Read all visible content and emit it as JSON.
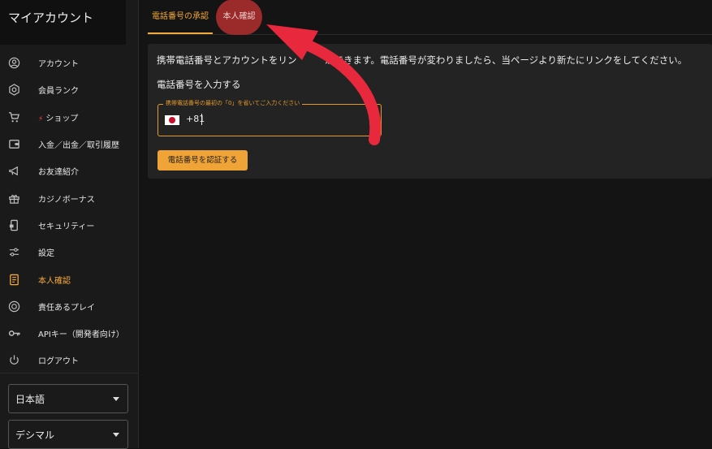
{
  "sidebar": {
    "title": "マイアカウント",
    "items": [
      {
        "label": "アカウント",
        "icon": "user-circle-icon",
        "name": "sidebar-item-account"
      },
      {
        "label": "会員ランク",
        "icon": "badge-hexagon-icon",
        "name": "sidebar-item-rank"
      },
      {
        "label": "ショップ",
        "icon": "cart-icon",
        "name": "sidebar-item-shop",
        "prefix_icon": "lightning-icon"
      },
      {
        "label": "入金／出金／取引履歴",
        "icon": "wallet-icon",
        "name": "sidebar-item-transactions"
      },
      {
        "label": "お友達紹介",
        "icon": "megaphone-icon",
        "name": "sidebar-item-referral"
      },
      {
        "label": "カジノボーナス",
        "icon": "gift-icon",
        "name": "sidebar-item-bonus"
      },
      {
        "label": "セキュリティー",
        "icon": "phone-lock-icon",
        "name": "sidebar-item-security"
      },
      {
        "label": "設定",
        "icon": "sliders-icon",
        "name": "sidebar-item-settings"
      },
      {
        "label": "本人確認",
        "icon": "id-document-icon",
        "name": "sidebar-item-verification",
        "active": true
      },
      {
        "label": "責任あるプレイ",
        "icon": "responsible-play-icon",
        "name": "sidebar-item-responsible"
      },
      {
        "label": "APIキー（開発者向け）",
        "icon": "key-icon",
        "name": "sidebar-item-api"
      },
      {
        "label": "ログアウト",
        "icon": "power-icon",
        "name": "sidebar-item-logout"
      }
    ],
    "language_select": "日本語",
    "odds_select": "デシマル"
  },
  "tabs": {
    "phone": "電話番号の承認",
    "kyc": "本人確認"
  },
  "panel": {
    "info": "携帯電話番号とアカウントをリン　　　ができます。電話番号が変わりましたら、当ページより新たにリンクをしてください。",
    "subhead": "電話番号を入力する",
    "field_legend": "携帯電話番号の最初の「0」を省いてご入力ください",
    "country_code": "+81",
    "verify_button": "電話番号を認証する"
  },
  "colors": {
    "accent": "#f5a93a",
    "arrow": "#e8283c",
    "tab_highlight": "#9b2a2a"
  }
}
